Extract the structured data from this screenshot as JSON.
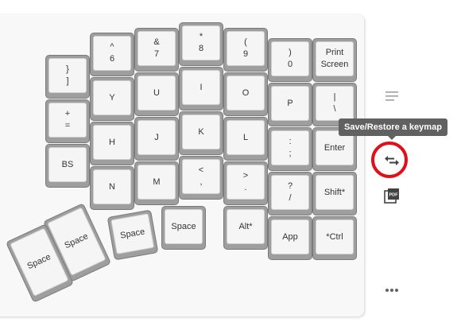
{
  "keys": [
    {
      "id": "paren-close-bracket-close",
      "top": "}",
      "bottom": "]"
    },
    {
      "id": "plus-equals",
      "top": "+",
      "bottom": "="
    },
    {
      "id": "bs",
      "top": "",
      "bottom": "BS"
    },
    {
      "id": "caret-6",
      "top": "^",
      "bottom": "6"
    },
    {
      "id": "y",
      "top": "",
      "bottom": "Y"
    },
    {
      "id": "h",
      "top": "",
      "bottom": "H"
    },
    {
      "id": "n",
      "top": "",
      "bottom": "N"
    },
    {
      "id": "amp-7",
      "top": "&",
      "bottom": "7"
    },
    {
      "id": "u",
      "top": "",
      "bottom": "U"
    },
    {
      "id": "j",
      "top": "",
      "bottom": "J"
    },
    {
      "id": "m",
      "top": "",
      "bottom": "M"
    },
    {
      "id": "star-8",
      "top": "*",
      "bottom": "8"
    },
    {
      "id": "i",
      "top": "",
      "bottom": "I"
    },
    {
      "id": "k",
      "top": "",
      "bottom": "K"
    },
    {
      "id": "lt-comma",
      "top": "<",
      "bottom": ","
    },
    {
      "id": "paren-9",
      "top": "(",
      "bottom": "9"
    },
    {
      "id": "o",
      "top": "",
      "bottom": "O"
    },
    {
      "id": "l",
      "top": "",
      "bottom": "L"
    },
    {
      "id": "gt-period",
      "top": ">",
      "bottom": "."
    },
    {
      "id": "paren-0",
      "top": ")",
      "bottom": "0"
    },
    {
      "id": "p",
      "top": "",
      "bottom": "P"
    },
    {
      "id": "colon-semicolon",
      "top": ":",
      "bottom": ";"
    },
    {
      "id": "question-slash",
      "top": "?",
      "bottom": "/"
    },
    {
      "id": "print-screen",
      "top": "Print",
      "bottom": "Screen"
    },
    {
      "id": "pipe-backslash",
      "top": "|",
      "bottom": "\\"
    },
    {
      "id": "enter",
      "top": "",
      "bottom": "Enter"
    },
    {
      "id": "shift",
      "top": "",
      "bottom": "Shift*"
    },
    {
      "id": "alt",
      "top": "",
      "bottom": "Alt*"
    },
    {
      "id": "app",
      "top": "",
      "bottom": "App"
    },
    {
      "id": "ctrl",
      "top": "",
      "bottom": "*Ctrl"
    },
    {
      "id": "space-4",
      "top": "",
      "bottom": "Space"
    },
    {
      "id": "space-3",
      "top": "",
      "bottom": "Space"
    },
    {
      "id": "space-2",
      "top": "",
      "bottom": "Space"
    },
    {
      "id": "space-1",
      "top": "",
      "bottom": "Space"
    }
  ],
  "sidebar": {
    "menu_icon": "menu-lines-icon",
    "swap_icon": "swap-arrows-icon",
    "pdf_icon": "pdf-icon",
    "pdf_label": "PDF",
    "more_icon": "more-horizontal-icon"
  },
  "tooltip": {
    "text": "Save/Restore a keymap"
  },
  "colors": {
    "highlight": "#e0101a",
    "tooltip_bg": "#616161",
    "icon": "#424242"
  }
}
